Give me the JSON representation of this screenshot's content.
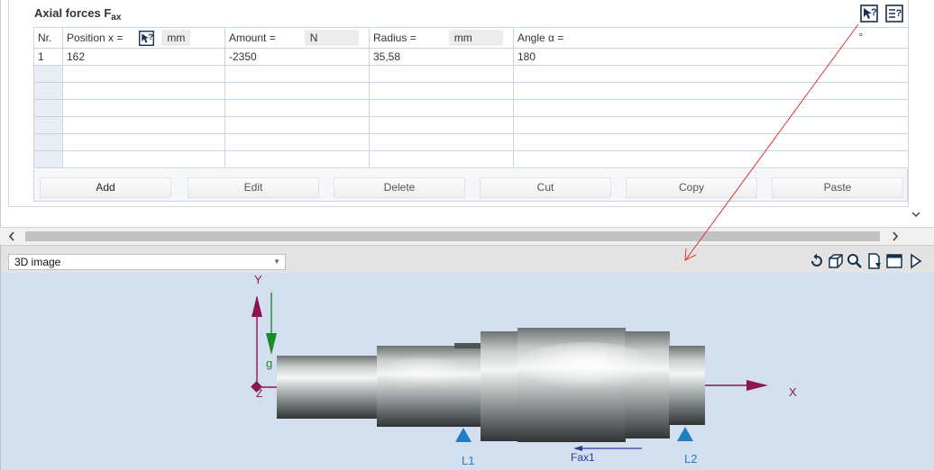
{
  "section": {
    "title_main": "Axial forces F",
    "title_sub": "ax"
  },
  "table": {
    "columns": {
      "nr": "Nr.",
      "position": "Position x =",
      "position_unit": "mm",
      "amount": "Amount =",
      "amount_unit": "N",
      "radius": "Radius =",
      "radius_unit": "mm",
      "angle": "Angle α =",
      "angle_unit": "°"
    },
    "rows": [
      {
        "nr": "1",
        "position": "162",
        "amount": "-2350",
        "radius": "35,58",
        "angle": "180"
      },
      {
        "nr": "",
        "position": "",
        "amount": "",
        "radius": "",
        "angle": ""
      },
      {
        "nr": "",
        "position": "",
        "amount": "",
        "radius": "",
        "angle": ""
      },
      {
        "nr": "",
        "position": "",
        "amount": "",
        "radius": "",
        "angle": ""
      },
      {
        "nr": "",
        "position": "",
        "amount": "",
        "radius": "",
        "angle": ""
      },
      {
        "nr": "",
        "position": "",
        "amount": "",
        "radius": "",
        "angle": ""
      },
      {
        "nr": "",
        "position": "",
        "amount": "",
        "radius": "",
        "angle": ""
      }
    ]
  },
  "buttons": {
    "add": "Add",
    "edit": "Edit",
    "delete": "Delete",
    "cut": "Cut",
    "copy": "Copy",
    "paste": "Paste"
  },
  "view": {
    "selected": "3D image"
  },
  "scene": {
    "axis_y": "Y",
    "axis_x": "X",
    "axis_z": "Z",
    "gravity": "g",
    "bearing_left": "L1",
    "bearing_right": "L2",
    "force": "Fax1"
  },
  "colors": {
    "axis": "#8a1650",
    "gravity": "#1a8a2a",
    "bearing": "#1f7ec4",
    "force": "#2b3c9a",
    "annotation": "#e23030",
    "icon": "#14304f"
  },
  "icons": {
    "help": "help-cursor-icon",
    "info": "info-list-icon",
    "rotate": "rotate-icon",
    "cube": "cube-icon",
    "zoom": "zoom-icon",
    "export": "export-icon",
    "window": "window-icon",
    "next": "play-next-icon"
  }
}
